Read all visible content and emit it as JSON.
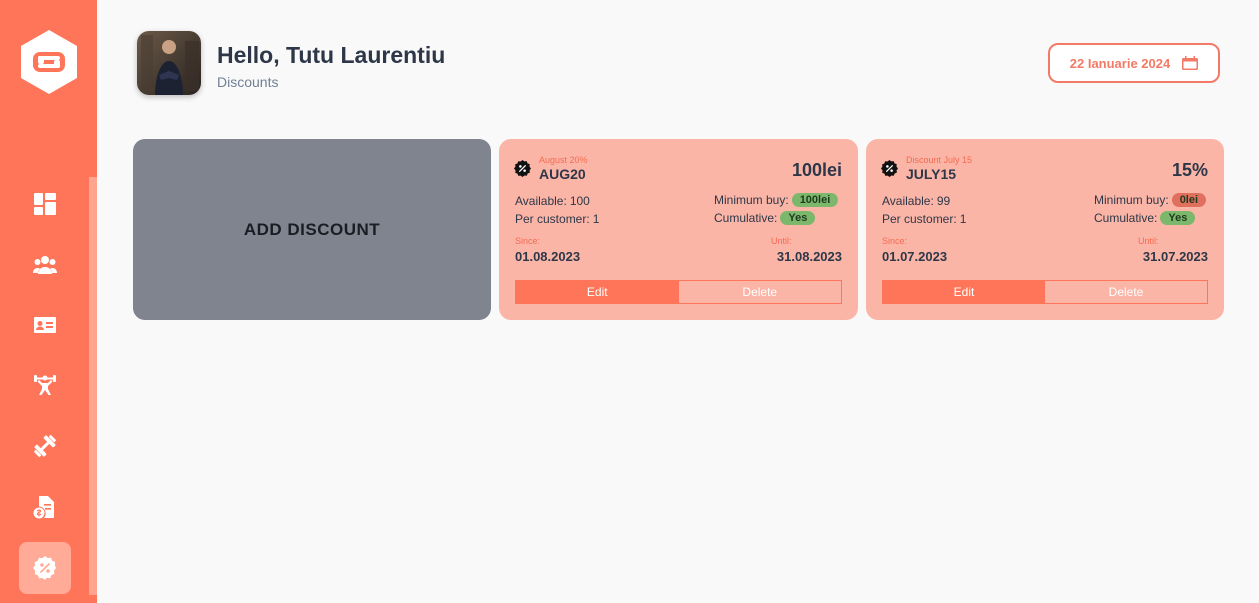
{
  "sidebar": {
    "logo_icon": "s-hexagon-logo",
    "items": [
      {
        "name": "dashboard",
        "icon": "dashboard-icon"
      },
      {
        "name": "users",
        "icon": "users-icon"
      },
      {
        "name": "members",
        "icon": "id-card-icon"
      },
      {
        "name": "trainers",
        "icon": "weightlifter-icon"
      },
      {
        "name": "equipment",
        "icon": "dumbbell-icon"
      },
      {
        "name": "reports",
        "icon": "file-dollar-icon"
      },
      {
        "name": "discounts",
        "icon": "percent-badge-icon",
        "active": true
      }
    ]
  },
  "header": {
    "greeting": "Hello, Tutu Laurentiu",
    "subtitle": "Discounts",
    "date": "22 Ianuarie 2024",
    "date_icon": "calendar-icon"
  },
  "add_card": {
    "label": "ADD DISCOUNT"
  },
  "discounts": [
    {
      "name": "August 20%",
      "code": "AUG20",
      "value": "100lei",
      "available_label": "Available:",
      "available": "100",
      "per_customer_label": "Per customer:",
      "per_customer": "1",
      "min_buy_label": "Minimum buy:",
      "min_buy": "100lei",
      "cumulative_label": "Cumulative:",
      "cumulative": "Yes",
      "since_label": "Since:",
      "since": "01.08.2023",
      "until_label": "Until:",
      "until": "31.08.2023",
      "edit_label": "Edit",
      "delete_label": "Delete"
    },
    {
      "name": "Discount July 15",
      "code": "JULY15",
      "value": "15%",
      "available_label": "Available:",
      "available": "99",
      "per_customer_label": "Per customer:",
      "per_customer": "1",
      "min_buy_label": "Minimum buy:",
      "min_buy": "0lei",
      "cumulative_label": "Cumulative:",
      "cumulative": "Yes",
      "since_label": "Since:",
      "since": "01.07.2023",
      "until_label": "Until:",
      "until": "31.07.2023",
      "edit_label": "Edit",
      "delete_label": "Delete"
    }
  ],
  "colors": {
    "sidebar": "#ff7559",
    "accent": "#f27a66",
    "card": "#fbb5a7",
    "add_card": "#80848e",
    "pill_green": "#7cb86c",
    "pill_red": "#e0705e"
  }
}
